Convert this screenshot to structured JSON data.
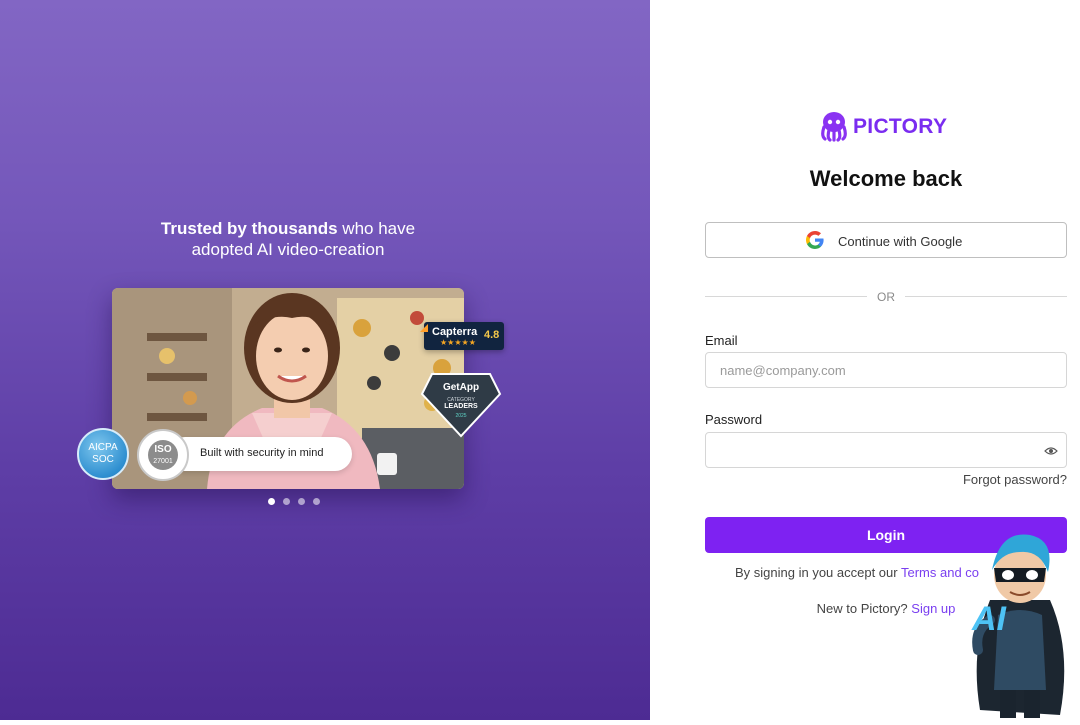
{
  "promo": {
    "tagline_bold": "Trusted by thousands",
    "tagline_rest": " who have",
    "tagline_line2": "adopted AI video-creation",
    "badges": {
      "capterra_name": "Capterra",
      "capterra_stars": "★★★★★",
      "capterra_rating": "4.8",
      "getapp_name": "GetApp",
      "getapp_category": "CATEGORY",
      "getapp_leaders": "LEADERS",
      "getapp_year": "2025",
      "aicpa_line1": "AICPA",
      "aicpa_line2": "SOC",
      "iso_line1": "ISO",
      "iso_line2": "27001"
    },
    "security_text": "Built with security in mind",
    "carousel": {
      "count": 4,
      "active_index": 0
    }
  },
  "brand": {
    "name": "PICTORY",
    "color": "#7a2cf0",
    "icon": "octopus-logo-icon"
  },
  "form": {
    "title": "Welcome back",
    "google_button": "Continue with Google",
    "divider_text": "OR",
    "email_label": "Email",
    "email_placeholder": "name@company.com",
    "email_value": "",
    "password_label": "Password",
    "password_value": "",
    "forgot_link": "Forgot password?",
    "login_button": "Login",
    "terms_prefix": "By signing in you accept our ",
    "terms_link": "Terms and co",
    "signup_prefix": "New to Pictory? ",
    "signup_link": "Sign up"
  },
  "mascot": {
    "text": "AI",
    "icon": "ai-superhero-mascot-icon"
  },
  "colors": {
    "primary": "#7e22f2",
    "panel_top": "#8266c4",
    "panel_bottom": "#4d2b93",
    "link": "#7a3ff0"
  }
}
